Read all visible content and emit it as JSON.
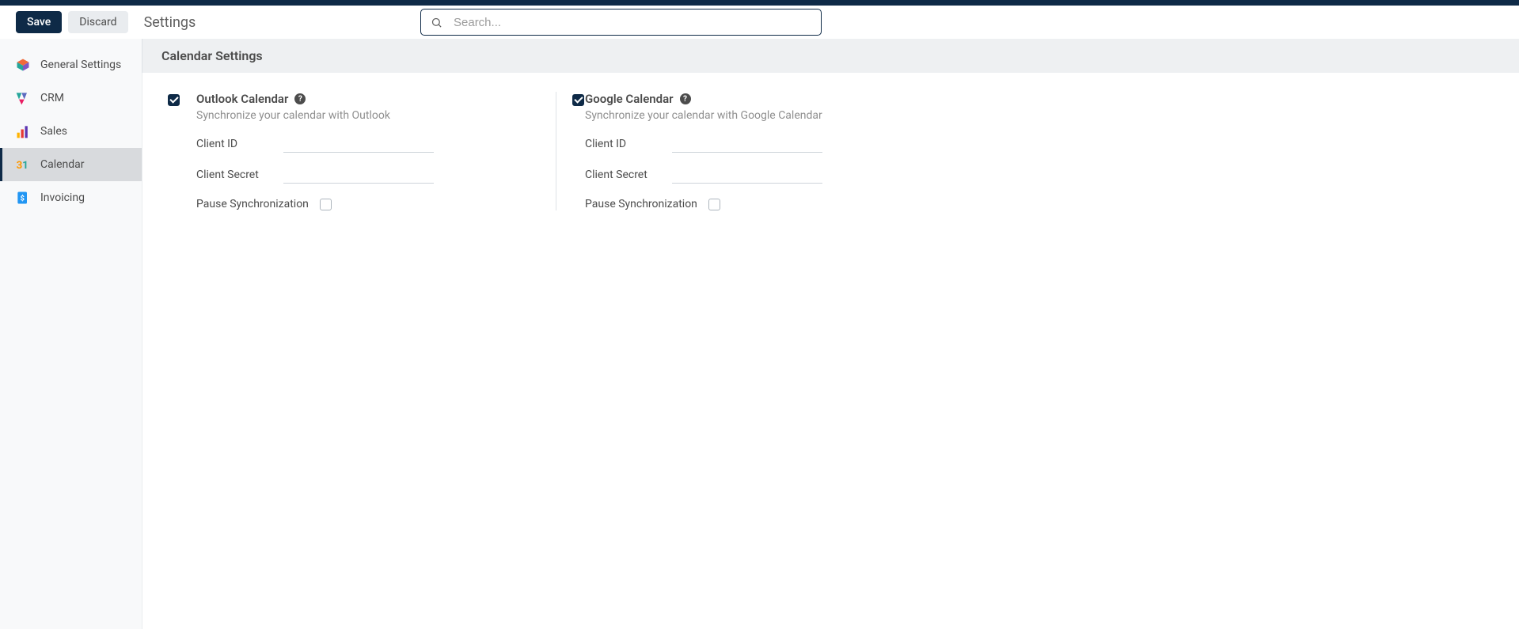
{
  "toolbar": {
    "save_label": "Save",
    "discard_label": "Discard",
    "page_title": "Settings"
  },
  "search": {
    "placeholder": "Search..."
  },
  "sidebar": {
    "items": [
      {
        "label": "General Settings"
      },
      {
        "label": "CRM"
      },
      {
        "label": "Sales"
      },
      {
        "label": "Calendar"
      },
      {
        "label": "Invoicing"
      }
    ]
  },
  "section": {
    "title": "Calendar Settings"
  },
  "outlook": {
    "title": "Outlook Calendar",
    "desc": "Synchronize your calendar with Outlook",
    "client_id_label": "Client ID",
    "client_secret_label": "Client Secret",
    "pause_label": "Pause Synchronization"
  },
  "google": {
    "title": "Google Calendar",
    "desc": "Synchronize your calendar with Google Calendar",
    "client_id_label": "Client ID",
    "client_secret_label": "Client Secret",
    "pause_label": "Pause Synchronization"
  }
}
